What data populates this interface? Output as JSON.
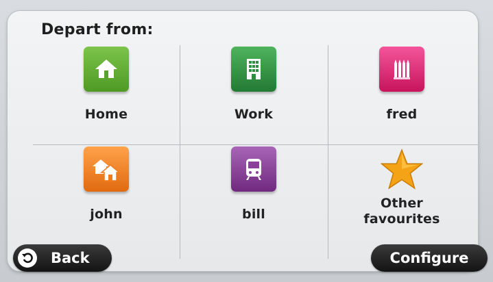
{
  "header": {
    "title": "Depart from:"
  },
  "items": [
    {
      "label": "Home",
      "icon": "home-icon",
      "color": "#5aa22c"
    },
    {
      "label": "Work",
      "icon": "office-building-icon",
      "color": "#2f8f3f"
    },
    {
      "label": "fred",
      "icon": "favourite-pencils-icon",
      "color": "#e0216f"
    },
    {
      "label": "john",
      "icon": "houses-icon",
      "color": "#f07c1c"
    },
    {
      "label": "bill",
      "icon": "train-icon",
      "color": "#8a3f9a"
    },
    {
      "label": "Other\nfavourites",
      "icon": "star-icon",
      "color": "#f4a316"
    }
  ],
  "footer": {
    "back_label": "Back",
    "configure_label": "Configure"
  }
}
